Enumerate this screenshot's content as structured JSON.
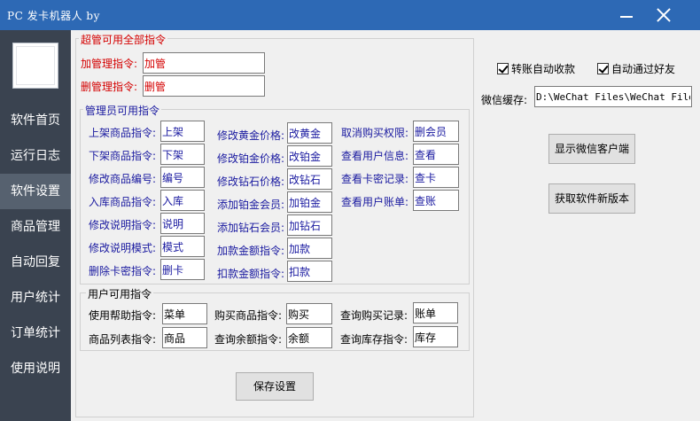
{
  "window": {
    "title": "PC 发卡机器人 by"
  },
  "sidebar": {
    "items": [
      {
        "label": "软件首页"
      },
      {
        "label": "运行日志"
      },
      {
        "label": "软件设置"
      },
      {
        "label": "商品管理"
      },
      {
        "label": "自动回复"
      },
      {
        "label": "用户统计"
      },
      {
        "label": "订单统计"
      },
      {
        "label": "使用说明"
      }
    ],
    "active_index": 2
  },
  "super_admin": {
    "legend": "超管可用全部指令",
    "add_admin_label": "加管理指令:",
    "add_admin_value": "加管",
    "del_admin_label": "删管理指令:",
    "del_admin_value": "删管"
  },
  "admin": {
    "legend": "管理员可用指令",
    "col1": [
      {
        "label": "上架商品指令:",
        "value": "上架"
      },
      {
        "label": "下架商品指令:",
        "value": "下架"
      },
      {
        "label": "修改商品编号:",
        "value": "编号"
      },
      {
        "label": "入库商品指令:",
        "value": "入库"
      },
      {
        "label": "修改说明指令:",
        "value": "说明"
      },
      {
        "label": "修改说明模式:",
        "value": "模式"
      },
      {
        "label": "删除卡密指令:",
        "value": "删卡"
      }
    ],
    "col2": [
      {
        "label": "修改黄金价格:",
        "value": "改黄金"
      },
      {
        "label": "修改铂金价格:",
        "value": "改铂金"
      },
      {
        "label": "修改钻石价格:",
        "value": "改钻石"
      },
      {
        "label": "添加铂金会员:",
        "value": "加铂金"
      },
      {
        "label": "添加钻石会员:",
        "value": "加钻石"
      },
      {
        "label": "加款金额指令:",
        "value": "加款"
      },
      {
        "label": "扣款金额指令:",
        "value": "扣款"
      }
    ],
    "col3": [
      {
        "label": "取消购买权限:",
        "value": "删会员"
      },
      {
        "label": "查看用户信息:",
        "value": "查看"
      },
      {
        "label": "查看卡密记录:",
        "value": "查卡"
      },
      {
        "label": "查看用户账单:",
        "value": "查账"
      }
    ]
  },
  "user": {
    "legend": "用户可用指令",
    "row1": [
      {
        "label": "使用帮助指令:",
        "value": "菜单"
      },
      {
        "label": "购买商品指令:",
        "value": "购买"
      },
      {
        "label": "查询购买记录:",
        "value": "账单"
      }
    ],
    "row2": [
      {
        "label": "商品列表指令:",
        "value": "商品"
      },
      {
        "label": "查询余额指令:",
        "value": "余额"
      },
      {
        "label": "查询库存指令:",
        "value": "库存"
      }
    ]
  },
  "right_panel": {
    "auto_transfer_label": "转账自动收款",
    "auto_transfer_checked": true,
    "auto_friend_label": "自动通过好友",
    "auto_friend_checked": true,
    "wechat_cache_label": "微信缓存:",
    "wechat_cache_value": "D:\\WeChat Files\\WeChat Files",
    "show_client_button": "显示微信客户端",
    "get_version_button": "获取软件新版本"
  },
  "save_button": "保存设置",
  "colors": {
    "titlebar": "#2d69b5",
    "sidebar": "#3a4350",
    "sidebar_active": "#56616f",
    "super_admin_text": "#d40000",
    "admin_text": "#1a1aa0"
  }
}
